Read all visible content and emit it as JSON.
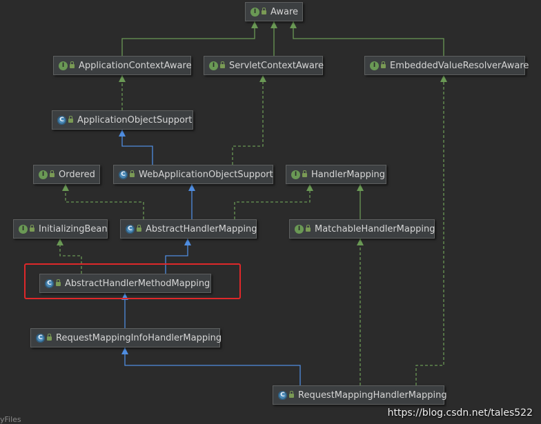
{
  "nodes": [
    {
      "id": "aware",
      "label": "Aware",
      "kind": "interface",
      "badge": "I"
    },
    {
      "id": "application-context-aware",
      "label": "ApplicationContextAware",
      "kind": "interface",
      "badge": "I"
    },
    {
      "id": "servlet-context-aware",
      "label": "ServletContextAware",
      "kind": "interface",
      "badge": "I"
    },
    {
      "id": "embedded-value-resolver-aware",
      "label": "EmbeddedValueResolverAware",
      "kind": "interface",
      "badge": "I"
    },
    {
      "id": "application-object-support",
      "label": "ApplicationObjectSupport",
      "kind": "class",
      "badge": "C"
    },
    {
      "id": "ordered",
      "label": "Ordered",
      "kind": "interface",
      "badge": "I"
    },
    {
      "id": "web-application-object-support",
      "label": "WebApplicationObjectSupport",
      "kind": "class",
      "badge": "C"
    },
    {
      "id": "handler-mapping",
      "label": "HandlerMapping",
      "kind": "interface",
      "badge": "I"
    },
    {
      "id": "initializing-bean",
      "label": "InitializingBean",
      "kind": "interface",
      "badge": "I"
    },
    {
      "id": "abstract-handler-mapping",
      "label": "AbstractHandlerMapping",
      "kind": "class",
      "badge": "C"
    },
    {
      "id": "matchable-handler-mapping",
      "label": "MatchableHandlerMapping",
      "kind": "interface",
      "badge": "I"
    },
    {
      "id": "abstract-handler-method-mapping",
      "label": "AbstractHandlerMethodMapping",
      "kind": "class",
      "badge": "C"
    },
    {
      "id": "request-mapping-info-handler-mapping",
      "label": "RequestMappingInfoHandlerMapping",
      "kind": "class",
      "badge": "C"
    },
    {
      "id": "request-mapping-handler-mapping",
      "label": "RequestMappingHandlerMapping",
      "kind": "class",
      "badge": "C"
    }
  ],
  "colors": {
    "extends": "#4f8de0",
    "implements": "#6a9955",
    "highlight": "#e0282a"
  },
  "watermark": "https://blog.csdn.net/tales522",
  "corner_text": "yFiles"
}
